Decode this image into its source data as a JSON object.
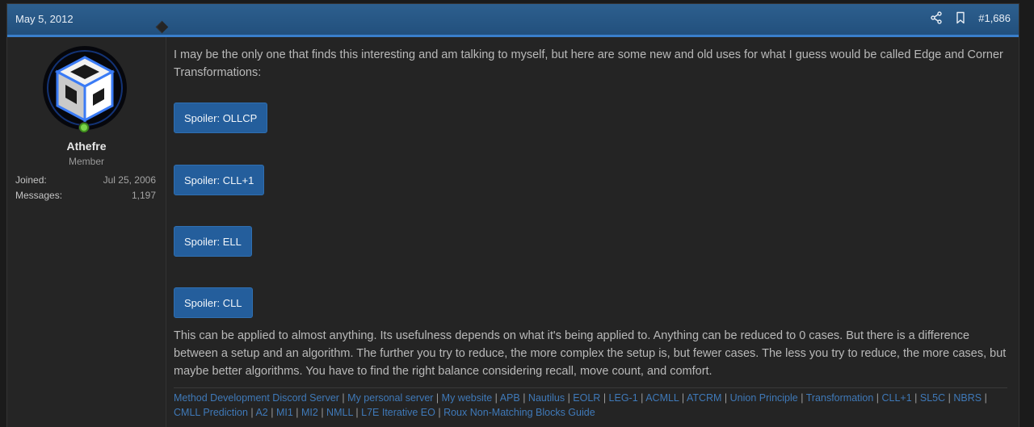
{
  "header": {
    "date": "May 5, 2012",
    "post_number": "#1,686",
    "icons": [
      "share-icon",
      "bookmark-icon"
    ]
  },
  "user": {
    "name": "Athefre",
    "title": "Member",
    "stats": [
      {
        "label": "Joined:",
        "value": "Jul 25, 2006"
      },
      {
        "label": "Messages:",
        "value": "1,197"
      }
    ],
    "online": true
  },
  "post": {
    "intro": "I may be the only one that finds this interesting and am talking to myself, but here are some new and old uses for what I guess would be called Edge and Corner Transformations:",
    "spoilers": [
      "Spoiler: OLLCP",
      "Spoiler: CLL+1",
      "Spoiler: ELL",
      "Spoiler: CLL"
    ],
    "paragraph": "This can be applied to almost anything. Its usefulness depends on what it's being applied to. Anything can be reduced to 0 cases. But there is a difference between a setup and an algorithm. The further you try to reduce, the more complex the setup is, but fewer cases. The less you try to reduce, the more cases, but maybe better algorithms. You have to find the right balance considering recall, move count, and comfort."
  },
  "signature": {
    "links": [
      "Method Development Discord Server",
      "My personal server",
      "My website",
      "APB",
      "Nautilus",
      "EOLR",
      "LEG-1",
      "ACMLL",
      "ATCRM",
      "Union Principle",
      "Transformation",
      "CLL+1",
      "SL5C",
      "NBRS",
      "CMLL Prediction",
      "A2",
      "MI1",
      "MI2",
      "NMLL",
      "L7E Iterative EO",
      "Roux Non-Matching Blocks Guide"
    ],
    "separator": "|"
  },
  "colors": {
    "header": "#22507d",
    "accent": "#3a7fcb",
    "spoiler": "#245e9c",
    "link": "#3f79b8",
    "online": "#7bd44a"
  }
}
